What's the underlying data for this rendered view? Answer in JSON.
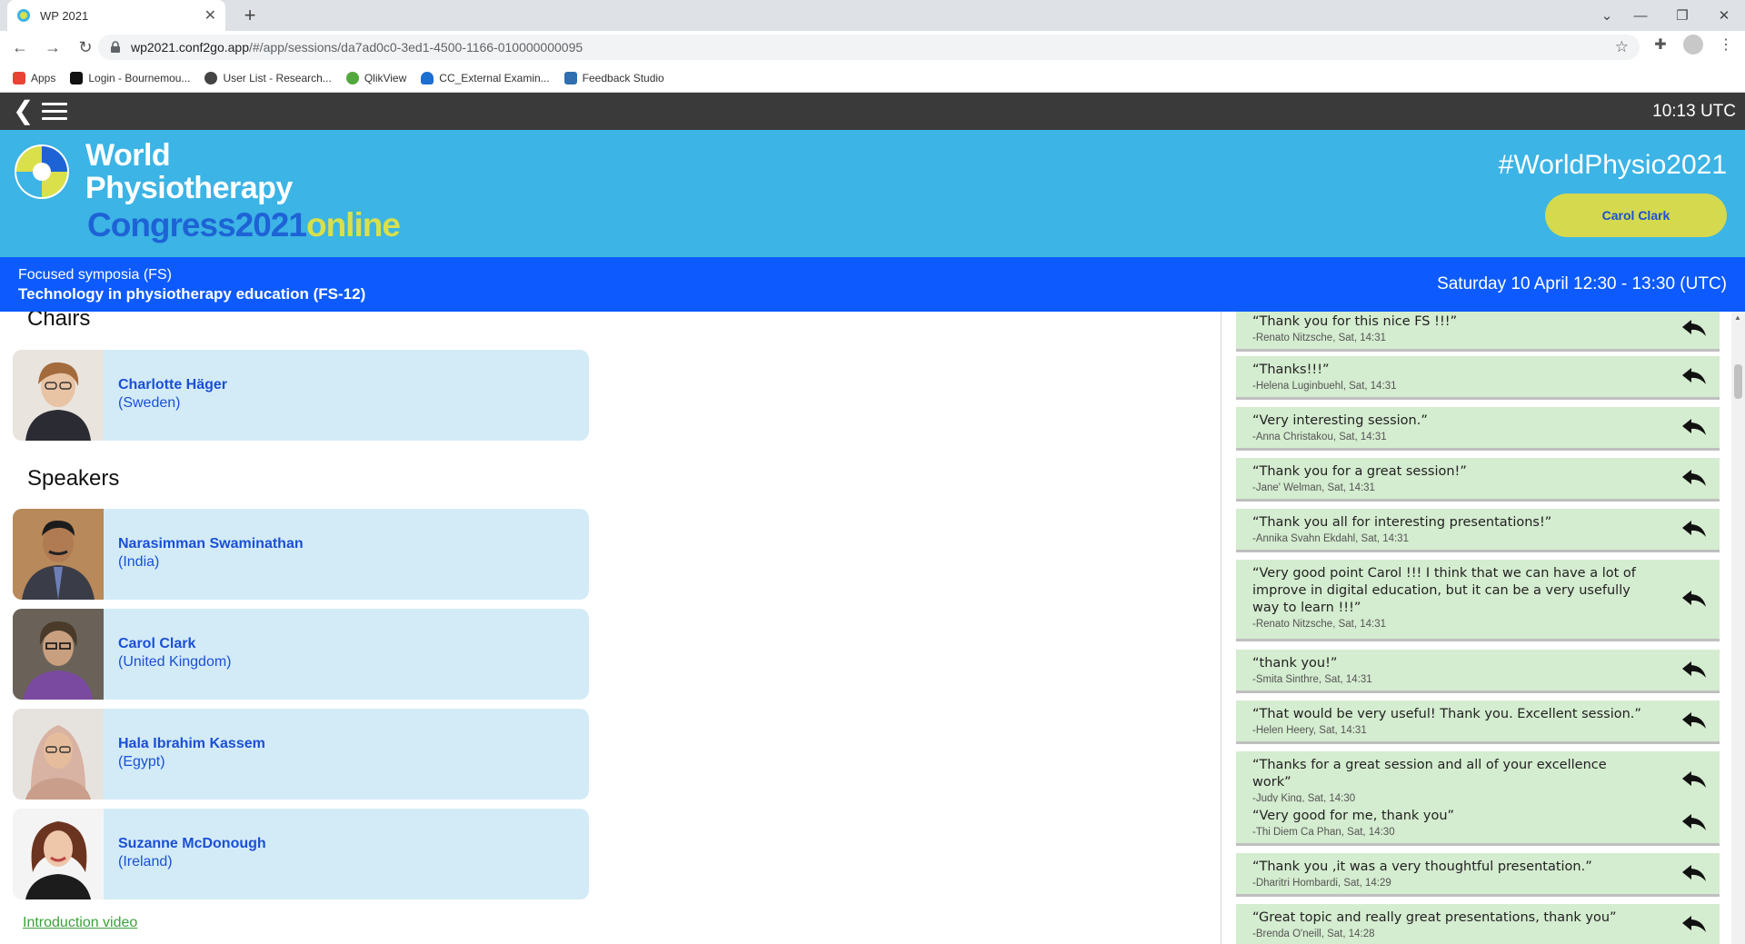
{
  "browser": {
    "tab_title": "WP 2021",
    "new_tab": "+",
    "url_host": "wp2021.conf2go.app",
    "url_path": "/#/app/sessions/da7ad0c0-3ed1-4500-1166-010000000095",
    "bookmarks": [
      {
        "label": "Apps",
        "color": "#ea4335"
      },
      {
        "label": "Login - Bournemou...",
        "color": "#111111"
      },
      {
        "label": "User List - Research...",
        "color": "#444444"
      },
      {
        "label": "QlikView",
        "color": "#52a83c"
      },
      {
        "label": "CC_External Examin...",
        "color": "#1b6fd1"
      },
      {
        "label": "Feedback Studio",
        "color": "#2f6fb0"
      }
    ]
  },
  "appbar": {
    "clock": "10:13 UTC"
  },
  "banner": {
    "logo_line1": "World",
    "logo_line2": "Physiotherapy",
    "logo_congress": "Congress2021",
    "logo_online": "online",
    "hashtag": "#WorldPhysio2021",
    "user_name": "Carol Clark"
  },
  "session": {
    "category": "Focused symposia (FS)",
    "title": "Technology in physiotherapy education (FS-12)",
    "time": "Saturday 10 April 12:30 - 13:30 (UTC)"
  },
  "chairs_heading": "Chairs",
  "speakers_heading": "Speakers",
  "chairs": [
    {
      "name": "Charlotte Häger",
      "country": "(Sweden)"
    }
  ],
  "speakers": [
    {
      "name": "Narasimman Swaminathan",
      "country": "(India)"
    },
    {
      "name": "Carol Clark",
      "country": "(United Kingdom)"
    },
    {
      "name": "Hala Ibrahim Kassem",
      "country": "(Egypt)"
    },
    {
      "name": "Suzanne McDonough",
      "country": "(Ireland)"
    }
  ],
  "intro_link": "Introduction video",
  "comments": [
    {
      "text": "“Thank you for this nice FS !!!”",
      "meta": "-Renato Nitzsche, Sat, 14:31"
    },
    {
      "text": "“Thanks!!!”",
      "meta": "-Helena Luginbuehl, Sat, 14:31"
    },
    {
      "text": "“Very interesting session.”",
      "meta": "-Anna Christakou, Sat, 14:31"
    },
    {
      "text": "“Thank you for a great session!”",
      "meta": "-Jane' Welman, Sat, 14:31"
    },
    {
      "text": "“Thank you all for interesting presentations!”",
      "meta": "-Annika Svahn Ekdahl, Sat, 14:31"
    },
    {
      "text": "“Very good point Carol !!! I think that we can have a lot of improve in digital education, but it can be a very usefully way to learn !!!”",
      "meta": "-Renato Nitzsche, Sat, 14:31"
    },
    {
      "text": "“thank you!”",
      "meta": "-Smita Sinthre, Sat, 14:31"
    },
    {
      "text": "“That would be very useful! Thank you. Excellent session.”",
      "meta": "-Helen Heery, Sat, 14:31"
    },
    {
      "text": "“Thanks for a great session and all of your excellence work”",
      "meta": "-Judy King, Sat, 14:30"
    },
    {
      "text": "“Very good for me, thank you”",
      "meta": "-Thi Diem Ca Phan, Sat, 14:30"
    },
    {
      "text": "“Thank you ,it was a very thoughtful presentation.”",
      "meta": "-Dharitri Hombardi, Sat, 14:29"
    },
    {
      "text": "“Great topic and really great presentations, thank you”",
      "meta": "-Brenda O'neill, Sat, 14:28"
    }
  ]
}
